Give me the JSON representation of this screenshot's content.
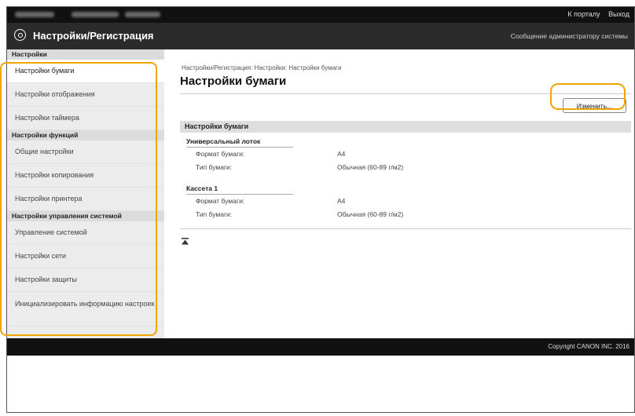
{
  "topbar": {
    "links": [
      "К порталу",
      "Выход"
    ]
  },
  "header": {
    "title": "Настройки/Регистрация",
    "admin_link": "Сообщение администратору системы"
  },
  "sidebar": {
    "sections": [
      {
        "title": "Настройки",
        "items": [
          "Настройки бумаги",
          "Настройки отображения",
          "Настройки таймера"
        ]
      },
      {
        "title": "Настройки функций",
        "items": [
          "Общие настройки",
          "Настройки копирования",
          "Настройки принтера"
        ]
      },
      {
        "title": "Настройки управления системой",
        "items": [
          "Управление системой",
          "Настройки сети",
          "Настройки защиты",
          "Инициализировать информацию настроек"
        ]
      }
    ]
  },
  "main": {
    "breadcrumb": "Настройки/Регистрация: Настройки: Настройки бумаги",
    "title": "Настройки бумаги",
    "edit_button": "Изменить...",
    "section_title": "Настройки бумаги",
    "groups": [
      {
        "title": "Универсальный лоток",
        "rows": [
          {
            "label": "Формат бумаги:",
            "value": "A4"
          },
          {
            "label": "Тип бумаги:",
            "value": "Обычная (60-89 г/м2)"
          }
        ]
      },
      {
        "title": "Кассета 1",
        "rows": [
          {
            "label": "Формат бумаги:",
            "value": "A4"
          },
          {
            "label": "Тип бумаги:",
            "value": "Обычная (60-89 г/м2)"
          }
        ]
      }
    ]
  },
  "footer": {
    "copyright": "Copyright CANON INC. 2016"
  },
  "colors": {
    "highlight": "#f0a500",
    "header_bg": "#2b2b2b",
    "topbar_bg": "#111111"
  },
  "icons": {
    "logo": "settings-gear-icon",
    "top": "back-to-top-icon"
  }
}
